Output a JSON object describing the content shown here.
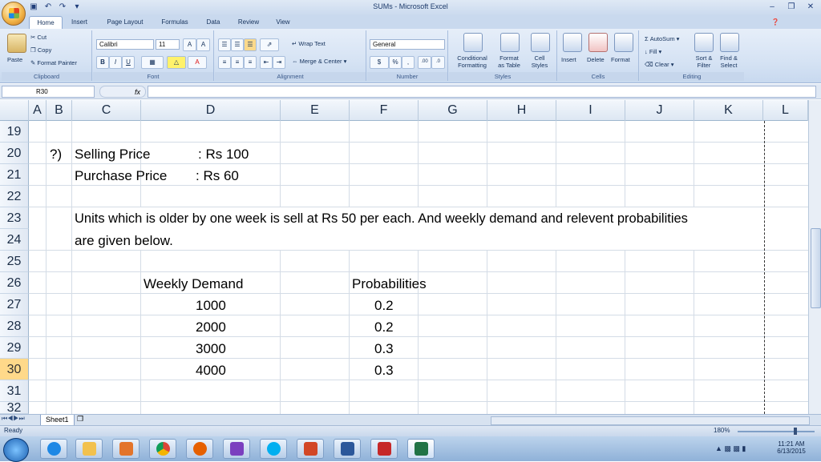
{
  "window": {
    "title": "SUMs - Microsoft Excel"
  },
  "ribbon": {
    "tabs": [
      "Home",
      "Insert",
      "Page Layout",
      "Formulas",
      "Data",
      "Review",
      "View"
    ],
    "clipboard": {
      "paste": "Paste",
      "cut": "Cut",
      "copy": "Copy",
      "format_painter": "Format Painter",
      "label": "Clipboard"
    },
    "font": {
      "name": "Calibri",
      "size": "11",
      "label": "Font"
    },
    "alignment": {
      "wrap_text": "Wrap Text",
      "merge_center": "Merge & Center",
      "label": "Alignment"
    },
    "number": {
      "format": "General",
      "label": "Number"
    },
    "styles": {
      "conditional": "Conditional",
      "conditional2": "Formatting",
      "format_as": "Format",
      "format_as2": "as Table",
      "cell": "Cell",
      "cell2": "Styles",
      "label": "Styles"
    },
    "cells": {
      "insert": "Insert",
      "delete": "Delete",
      "format": "Format",
      "label": "Cells"
    },
    "editing": {
      "autosum": "AutoSum",
      "fill": "Fill",
      "clear": "Clear",
      "sort": "Sort &",
      "sort2": "Filter",
      "find": "Find &",
      "find2": "Select",
      "label": "Editing"
    }
  },
  "formula_bar": {
    "name_box": "R30",
    "fx": "fx",
    "content": ""
  },
  "columns": [
    "A",
    "B",
    "C",
    "D",
    "E",
    "F",
    "G",
    "H",
    "I",
    "J",
    "K",
    "L"
  ],
  "rows": [
    "19",
    "20",
    "21",
    "22",
    "23",
    "24",
    "25",
    "26",
    "27",
    "28",
    "29",
    "30",
    "31",
    "32"
  ],
  "selected_row": "30",
  "cells": {
    "b20": "?)",
    "c20": "Selling Price",
    "d20": ": Rs 100",
    "c21": "Purchase Price",
    "d21": ": Rs 60",
    "c23": "Units which is older by one week is sell at Rs 50 per each. And weekly demand and relevent probabilities",
    "c24": "are given below.",
    "d26": "Weekly Demand",
    "f26": "Probabilities",
    "d27": "1000",
    "f27": "0.2",
    "d28": "2000",
    "f28": "0.2",
    "d29": "3000",
    "f29": "0.3",
    "d30": "4000",
    "f30": "0.3"
  },
  "sheet_tab": "Sheet1",
  "status": {
    "ready": "Ready",
    "zoom": "180%"
  },
  "clock": {
    "time": "11:21 AM",
    "date": "6/13/2015"
  }
}
